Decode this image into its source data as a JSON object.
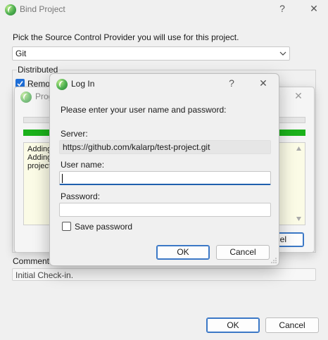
{
  "bind_window": {
    "title": "Bind Project",
    "help_glyph": "?",
    "close_glyph": "✕",
    "provider_prompt": "Pick the Source Control Provider you will use for this project.",
    "provider_value": "Git",
    "distributed_label": "Distributed",
    "remote_label": "Remot",
    "comment_label": "Comment:",
    "comment_value": "Initial Check-in.",
    "ok_label": "OK",
    "cancel_label": "Cancel"
  },
  "progress_window": {
    "title": "Prog",
    "close_glyph": "✕",
    "log_lines": [
      "Adding",
      "Adding",
      "project"
    ],
    "cancel_fragment": "ncel"
  },
  "login_dialog": {
    "title": "Log In",
    "help_glyph": "?",
    "close_glyph": "✕",
    "instruction": "Please enter your user name and password:",
    "server_label": "Server:",
    "server_value": "https://github.com/kalarp/test-project.git",
    "username_label": "User name:",
    "username_value": "",
    "password_label": "Password:",
    "password_value": "",
    "save_password_label": "Save password",
    "save_password_checked": false,
    "ok_label": "OK",
    "cancel_label": "Cancel"
  },
  "icons": {
    "app_logo": "green-leaf-logo-icon",
    "dropdown": "chevron-down-icon",
    "checkbox_checked": "checkmark-icon"
  },
  "colors": {
    "accent": "#1e6fd9",
    "progress_green": "#1bb11b",
    "log_background": "#fbfbe6",
    "focus_underline": "#1f5fae"
  }
}
